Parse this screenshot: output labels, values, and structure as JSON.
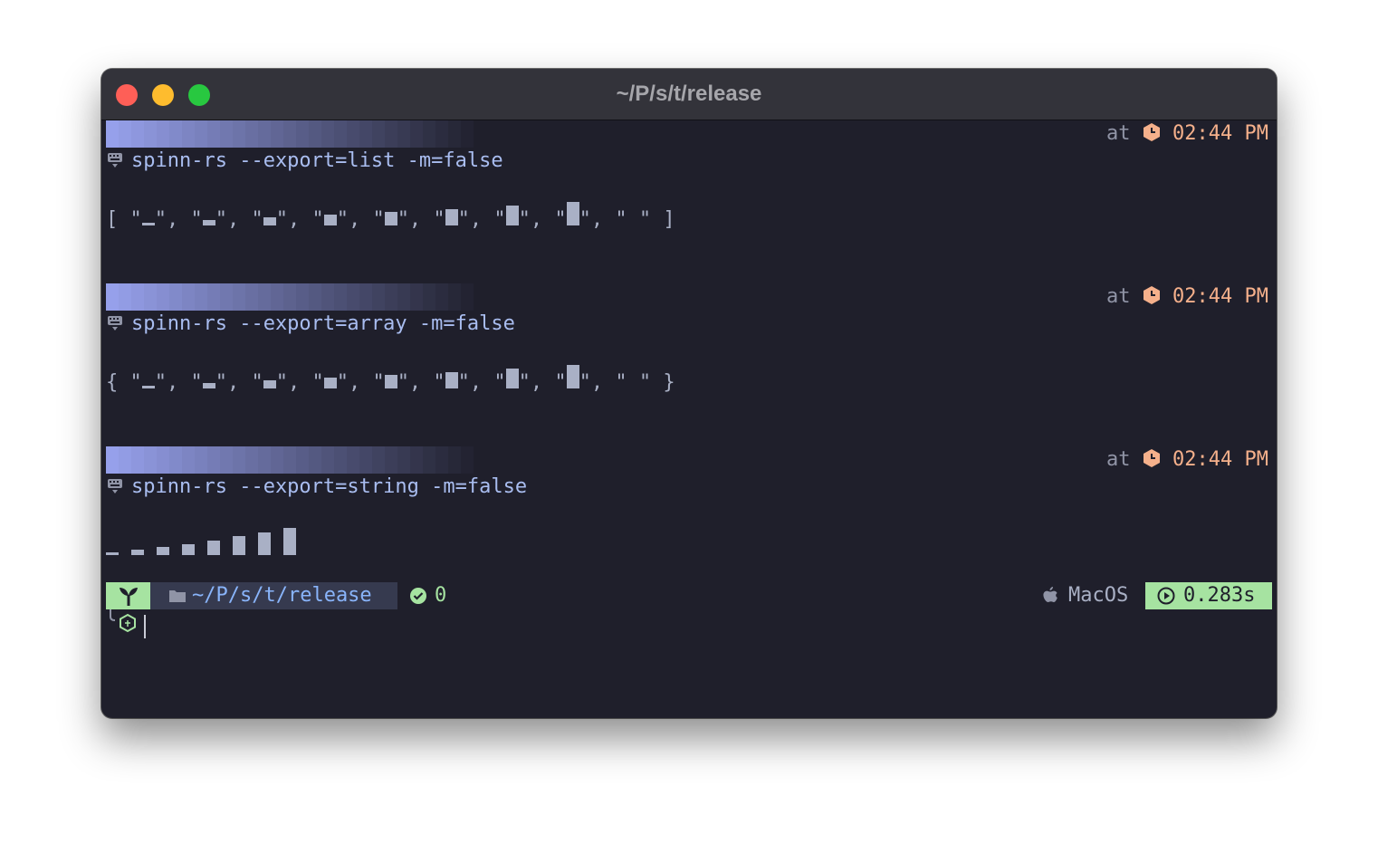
{
  "window": {
    "title": "~/P/s/t/release"
  },
  "blocks": [
    {
      "time_prefix": "at",
      "time": "02:44 PM",
      "command": "spinn-rs --export=list -m=false",
      "output_open": "[",
      "output_close": "]"
    },
    {
      "time_prefix": "at",
      "time": "02:44 PM",
      "command": "spinn-rs --export=array -m=false",
      "output_open": "{",
      "output_close": "}"
    },
    {
      "time_prefix": "at",
      "time": "02:44 PM",
      "command": "spinn-rs --export=string -m=false"
    }
  ],
  "prompt": {
    "path": "~/P/s/t/release",
    "exit_code": "0",
    "os": "MacOS",
    "duration": "0.283s"
  },
  "colors": {
    "background": "#1f1f2b",
    "titlebar": "#33333a",
    "accent_green": "#a6e3a1",
    "path_blue": "#89b4fa",
    "clock_orange": "#f5b08b",
    "command_blue": "#a9bdf0"
  },
  "icons": {
    "keyboard": "keyboard-icon",
    "clock": "hexagon-clock-icon",
    "branch": "sprout-icon",
    "folder": "folder-icon",
    "check": "check-circle-icon",
    "os": "apple-icon",
    "duration": "stopwatch-icon",
    "prompt": "nodejs-hex-icon"
  }
}
